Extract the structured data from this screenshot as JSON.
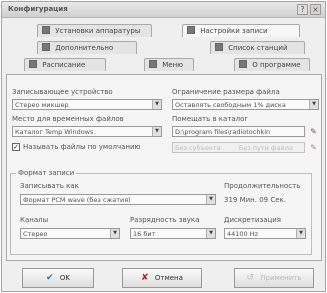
{
  "window": {
    "title": "Конфигурация",
    "help_glyph": "?",
    "close_glyph": "×"
  },
  "tabs": [
    {
      "label": "Установки аппаратуры"
    },
    {
      "label": "Настройки записи"
    },
    {
      "label": "Дополнительно"
    },
    {
      "label": "Список станций"
    },
    {
      "label": "Расписание"
    },
    {
      "label": "Меню"
    },
    {
      "label": "О программе"
    }
  ],
  "recording": {
    "device_label": "Записывающее устройство",
    "device_value": "Стерео микшер",
    "size_limit_label": "Ограничение размера файла",
    "size_limit_value": "Оставлять свободным 1% диска",
    "temp_location_label": "Место для временных файлов",
    "temp_location_value": "Каталог Temp Windows",
    "save_dir_label": "Помещать в каталог",
    "save_dir_value": "D:\\program files\\radiotochkin",
    "auto_name_checked": true,
    "auto_name_label": "Называть файлы по умолчанию",
    "auto_name_value_1": "Без субъекта",
    "auto_name_value_2": "Без пути файла",
    "check_glyph": "✓"
  },
  "format": {
    "group_label": "Формат записи",
    "codec_label": "Записывать как",
    "codec_value": "Формат PCM wave (без сжатия)",
    "duration_label": "Продолжительность",
    "duration_value": "319 Мин. 09 Сек.",
    "channels_label": "Каналы",
    "channels_value": "Стерео",
    "bitdepth_label": "Разрядность звука",
    "bitdepth_value": "16 бит",
    "samplerate_label": "Дискретизация",
    "samplerate_value": "44100 Hz"
  },
  "buttons": {
    "ok": "OK",
    "cancel": "Отмена",
    "apply": "Применить"
  },
  "icons": {
    "ok": "checkmark-icon",
    "cancel": "cross-icon",
    "apply": "apply-icon",
    "folder": "folder-icon",
    "dropdown": "chevron-down-icon"
  },
  "colors": {
    "window_bg": "#efefef",
    "tab_active": "#f7f7f7",
    "cancel_icon": "#b02020",
    "ok_icon": "#2c6fb0"
  }
}
